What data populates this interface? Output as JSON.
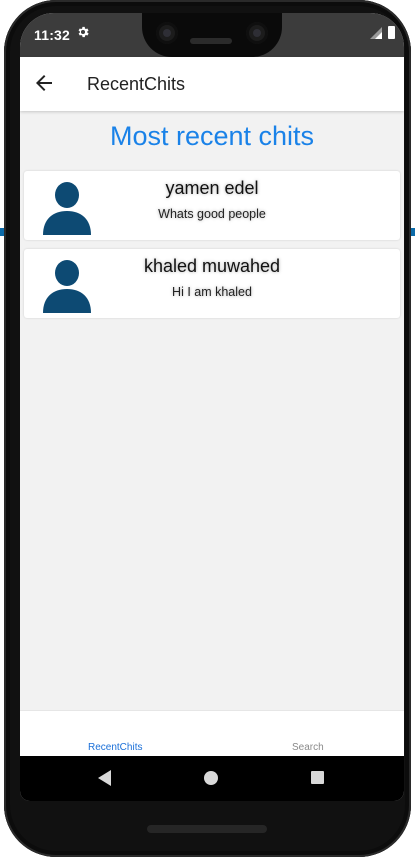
{
  "status_bar": {
    "time": "11:32",
    "icons": [
      "gear-icon",
      "signal-icon",
      "battery-icon"
    ]
  },
  "app_bar": {
    "back_icon": "arrow-left-icon",
    "title": "RecentChits"
  },
  "heading": "Most recent chits",
  "chits": [
    {
      "name": "yamen edel",
      "message": "Whats good people",
      "avatar_icon": "user-avatar-icon"
    },
    {
      "name": "khaled muwahed",
      "message": "Hi I am khaled",
      "avatar_icon": "user-avatar-icon"
    }
  ],
  "tabs": [
    {
      "label": "RecentChits",
      "active": true
    },
    {
      "label": "Search",
      "active": false
    }
  ],
  "nav_bar": [
    "back-triangle-icon",
    "home-circle-icon",
    "recents-square-icon"
  ],
  "colors": {
    "accent": "#1a82e8",
    "avatar": "#0d4a73",
    "active_tab": "#1a6fd8",
    "inactive_tab": "#8a8a8a"
  }
}
